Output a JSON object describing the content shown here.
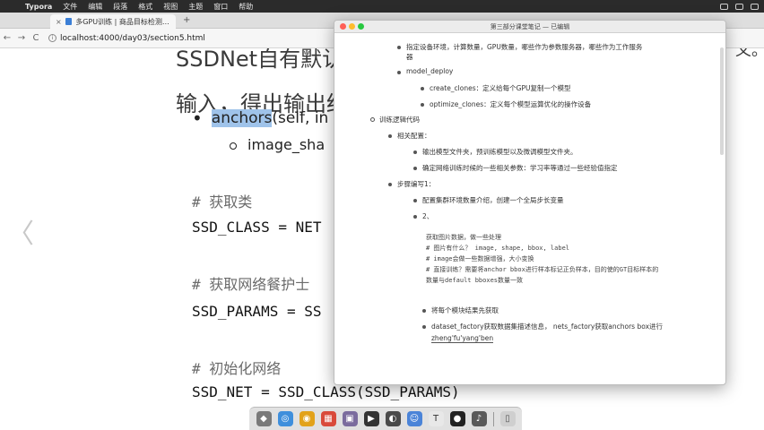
{
  "menubar": {
    "apple": "",
    "app_name": "Typora",
    "items": [
      "文件",
      "编辑",
      "段落",
      "格式",
      "视图",
      "主题",
      "窗口",
      "帮助"
    ]
  },
  "browser": {
    "tab_title": "多GPU训练 | 商品目标检测课程",
    "tab_close": "×",
    "new_tab": "+",
    "url": "localhost:4000/day03/section5.html",
    "back": "←",
    "forward": "→",
    "reload": "C"
  },
  "slide": {
    "head_top": "SSDNet自有默认de",
    "head_text": "输入，得出输出结果",
    "bullet_anchor": "anchors",
    "bullet_rest": "(self, in",
    "sub_bullet": "image_sha",
    "code_lines": [
      {
        "text": "# 获取类",
        "cmt": true
      },
      {
        "text": "SSD_CLASS = NET",
        "cmt": false
      },
      {
        "text": "# 获取网络餐护士",
        "cmt": true
      },
      {
        "text": "SSD_PARAMS = SS",
        "cmt": false
      },
      {
        "text": "# 初始化网络",
        "cmt": true
      },
      {
        "text": "SSD_NET = SSD_CLASS(SSD_PARAMS)",
        "cmt": false
      }
    ],
    "prev_arrow": "〈",
    "right_edge_text": "义。"
  },
  "typora": {
    "window_title": "第三部分课堂笔记 — 已编辑",
    "lines": {
      "l1": "指定设备环境，计算数量，GPU数量，哪些作为参数服务器，哪些作为工作服务",
      "l1b": "器",
      "l2": "model_deploy",
      "l3": "create_clones：定义给每个GPU复制一个模型",
      "l4": "optimize_clones：定义每个模型运算优化的操作设备",
      "l5": "训练逻辑代码",
      "l6": "相关配置：",
      "l7": "输出模型文件夹，预训练模型以及微调模型文件夹。",
      "l8": "确定网络训练时候的一些相关参数：学习率等通过一些经验值指定",
      "l9": "步骤编写1：",
      "l10": "配置集群环境数量介绍，创建一个全局步长变量",
      "l11": "2、",
      "c1": "获取图片数据，做一些处理",
      "c2": "# 图片有什么？ image, shape, bbox, label",
      "c3": "# image会做一些数据增强，大小变换",
      "c4": "# 直接训练？需要将anchor bbox进行样本标记正负样本，目的使的GT目标样本的",
      "c5": "数量与default bboxes数量一致",
      "l12": "将每个模块结果先获取",
      "l13": "dataset_factory获取数据集描述信息，  nets_factory获取anchors box进行",
      "l14": "zheng'fu'yang'ben"
    }
  },
  "dock": {
    "icons": [
      "launchpad-icon",
      "safari-icon",
      "chrome-icon",
      "calendar-icon",
      "photo-icon",
      "terminal-icon",
      "activity-icon",
      "finder-icon",
      "typora-icon",
      "quicktime-icon",
      "music-icon",
      "trash-icon"
    ],
    "colors": [
      "#7a7a7a",
      "#3f8fdc",
      "#e2a21a",
      "#d94a3b",
      "#7b6c9e",
      "#333333",
      "#4a4a4a",
      "#4b84d8",
      "#e8e8e8",
      "#222222",
      "#5a5a5a",
      "#cfcfcf"
    ],
    "glyphs": [
      "◆",
      "◎",
      "◉",
      "▦",
      "▣",
      "▶",
      "◐",
      "☺",
      "T",
      "●",
      "♪",
      "▯"
    ]
  }
}
